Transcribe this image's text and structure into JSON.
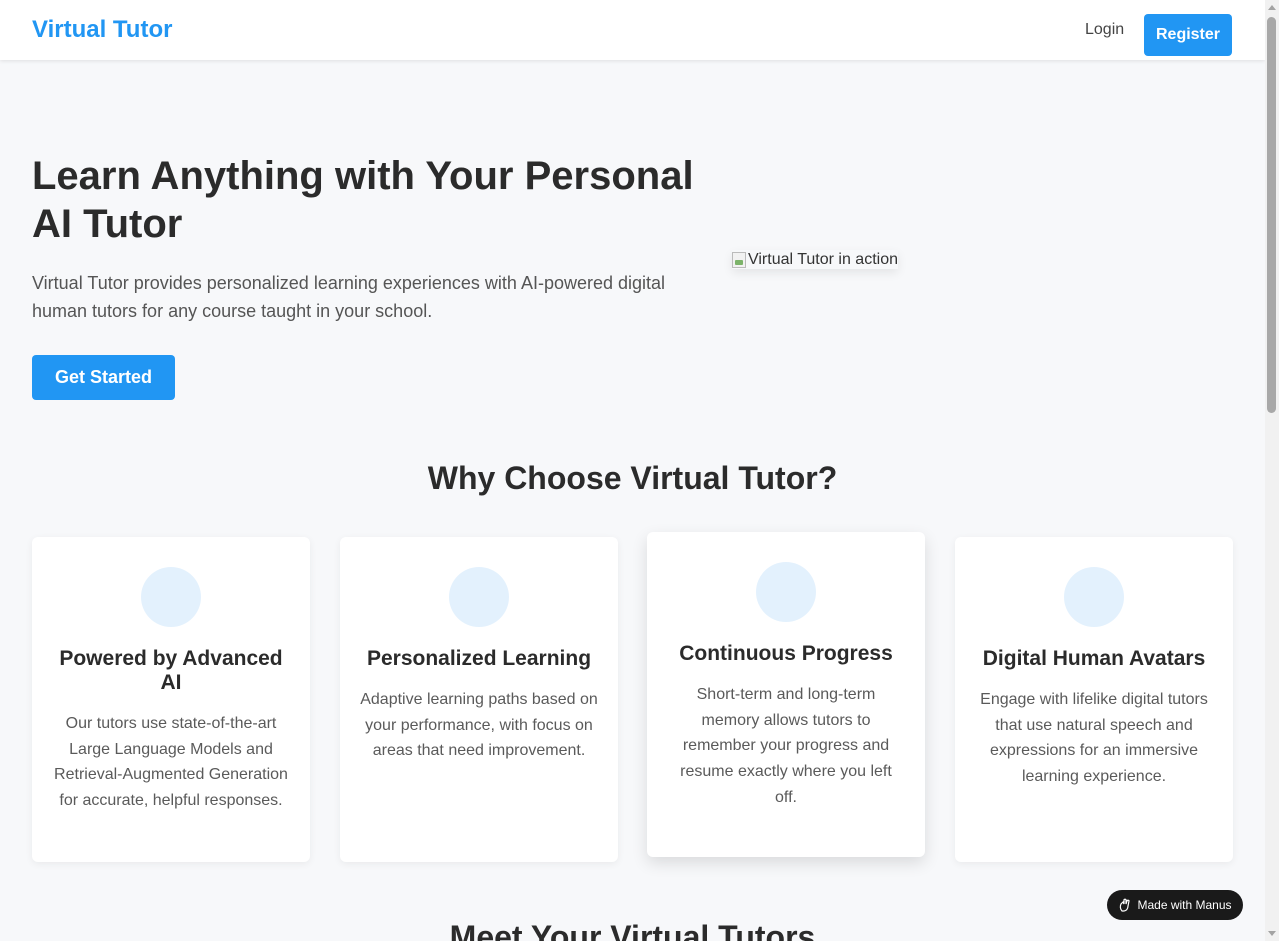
{
  "header": {
    "brand": "Virtual Tutor",
    "login_label": "Login",
    "register_label": "Register"
  },
  "hero": {
    "title": "Learn Anything with Your Personal AI Tutor",
    "description": "Virtual Tutor provides personalized learning experiences with AI-powered digital human tutors for any course taught in your school.",
    "cta_label": "Get Started",
    "image_alt": "Virtual Tutor in action"
  },
  "features": {
    "title": "Why Choose Virtual Tutor?",
    "items": [
      {
        "title": "Powered by Advanced AI",
        "description": "Our tutors use state-of-the-art Large Language Models and Retrieval-Augmented Generation for accurate, helpful responses."
      },
      {
        "title": "Personalized Learning",
        "description": "Adaptive learning paths based on your performance, with focus on areas that need improvement."
      },
      {
        "title": "Continuous Progress",
        "description": "Short-term and long-term memory allows tutors to remember your progress and resume exactly where you left off."
      },
      {
        "title": "Digital Human Avatars",
        "description": "Engage with lifelike digital tutors that use natural speech and expressions for an immersive learning experience."
      }
    ]
  },
  "tutors": {
    "title": "Meet Your Virtual Tutors"
  },
  "badge": {
    "label": "Made with Manus"
  },
  "colors": {
    "primary": "#2196f3",
    "background": "#f7f8fa",
    "icon_bg": "#e3f1fd"
  }
}
